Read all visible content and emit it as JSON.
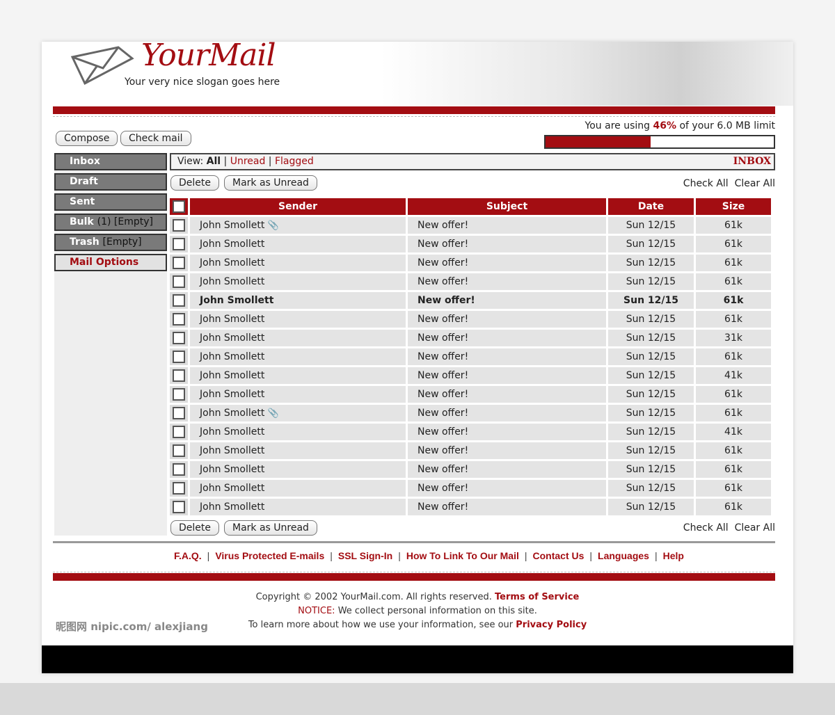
{
  "brand": {
    "name": "YourMail",
    "slogan": "Your very nice slogan goes here"
  },
  "toolbar": {
    "compose": "Compose",
    "check_mail": "Check mail"
  },
  "usage": {
    "prefix": "You are using",
    "percent": "46%",
    "suffix": "of your 6.0 MB limit",
    "fraction": 0.46
  },
  "sidebar": {
    "items": [
      {
        "label": "Inbox",
        "extra": ""
      },
      {
        "label": "Draft",
        "extra": ""
      },
      {
        "label": "Sent",
        "extra": ""
      },
      {
        "label": "Bulk",
        "extra": "(1) [Empty]"
      },
      {
        "label": "Trash",
        "extra": "[Empty]"
      },
      {
        "label": "Mail Options",
        "extra": ""
      }
    ]
  },
  "view": {
    "label": "View:",
    "all": "All",
    "unread": "Unread",
    "flagged": "Flagged",
    "folder": "INBOX"
  },
  "actions": {
    "delete": "Delete",
    "mark_unread": "Mark as Unread",
    "check_all": "Check All",
    "clear_all": "Clear All"
  },
  "table": {
    "headers": [
      "Sender",
      "Subject",
      "Date",
      "Size"
    ],
    "rows": [
      {
        "sender": "John Smollett",
        "subject": "New offer!",
        "date": "Sun 12/15",
        "size": "61k",
        "attachment": true,
        "unread": false
      },
      {
        "sender": "John Smollett",
        "subject": "New offer!",
        "date": "Sun 12/15",
        "size": "61k",
        "attachment": false,
        "unread": false
      },
      {
        "sender": "John Smollett",
        "subject": "New offer!",
        "date": "Sun 12/15",
        "size": "61k",
        "attachment": false,
        "unread": false
      },
      {
        "sender": "John Smollett",
        "subject": "New offer!",
        "date": "Sun 12/15",
        "size": "61k",
        "attachment": false,
        "unread": false
      },
      {
        "sender": "John Smollett",
        "subject": "New offer!",
        "date": "Sun 12/15",
        "size": "61k",
        "attachment": false,
        "unread": true
      },
      {
        "sender": "John Smollett",
        "subject": "New offer!",
        "date": "Sun 12/15",
        "size": "61k",
        "attachment": false,
        "unread": false
      },
      {
        "sender": "John Smollett",
        "subject": "New offer!",
        "date": "Sun 12/15",
        "size": "31k",
        "attachment": false,
        "unread": false
      },
      {
        "sender": "John Smollett",
        "subject": "New offer!",
        "date": "Sun 12/15",
        "size": "61k",
        "attachment": false,
        "unread": false
      },
      {
        "sender": "John Smollett",
        "subject": "New offer!",
        "date": "Sun 12/15",
        "size": "41k",
        "attachment": false,
        "unread": false
      },
      {
        "sender": "John Smollett",
        "subject": "New offer!",
        "date": "Sun 12/15",
        "size": "61k",
        "attachment": false,
        "unread": false
      },
      {
        "sender": "John Smollett",
        "subject": "New offer!",
        "date": "Sun 12/15",
        "size": "61k",
        "attachment": true,
        "unread": false
      },
      {
        "sender": "John Smollett",
        "subject": "New offer!",
        "date": "Sun 12/15",
        "size": "41k",
        "attachment": false,
        "unread": false
      },
      {
        "sender": "John Smollett",
        "subject": "New offer!",
        "date": "Sun 12/15",
        "size": "61k",
        "attachment": false,
        "unread": false
      },
      {
        "sender": "John Smollett",
        "subject": "New offer!",
        "date": "Sun 12/15",
        "size": "61k",
        "attachment": false,
        "unread": false
      },
      {
        "sender": "John Smollett",
        "subject": "New offer!",
        "date": "Sun 12/15",
        "size": "61k",
        "attachment": false,
        "unread": false
      },
      {
        "sender": "John Smollett",
        "subject": "New offer!",
        "date": "Sun 12/15",
        "size": "61k",
        "attachment": false,
        "unread": false
      }
    ]
  },
  "footer": {
    "links": [
      "F.A.Q.",
      "Virus Protected E-mails",
      "SSL Sign-In",
      "How To Link To Our Mail",
      "Contact Us",
      "Languages",
      "Help"
    ],
    "copyright": "Copyright © 2002 YourMail.com.  All rights reserved.",
    "terms": "Terms of Service",
    "notice_label": "NOTICE:",
    "notice": "We collect personal information on this site.",
    "learn": "To learn more about how we use your information, see our",
    "privacy": "Privacy Policy"
  },
  "watermark": "昵图网 nipic.com/ alexjiang",
  "colors": {
    "accent": "#a30d12",
    "nav": "#7a7a7a"
  }
}
